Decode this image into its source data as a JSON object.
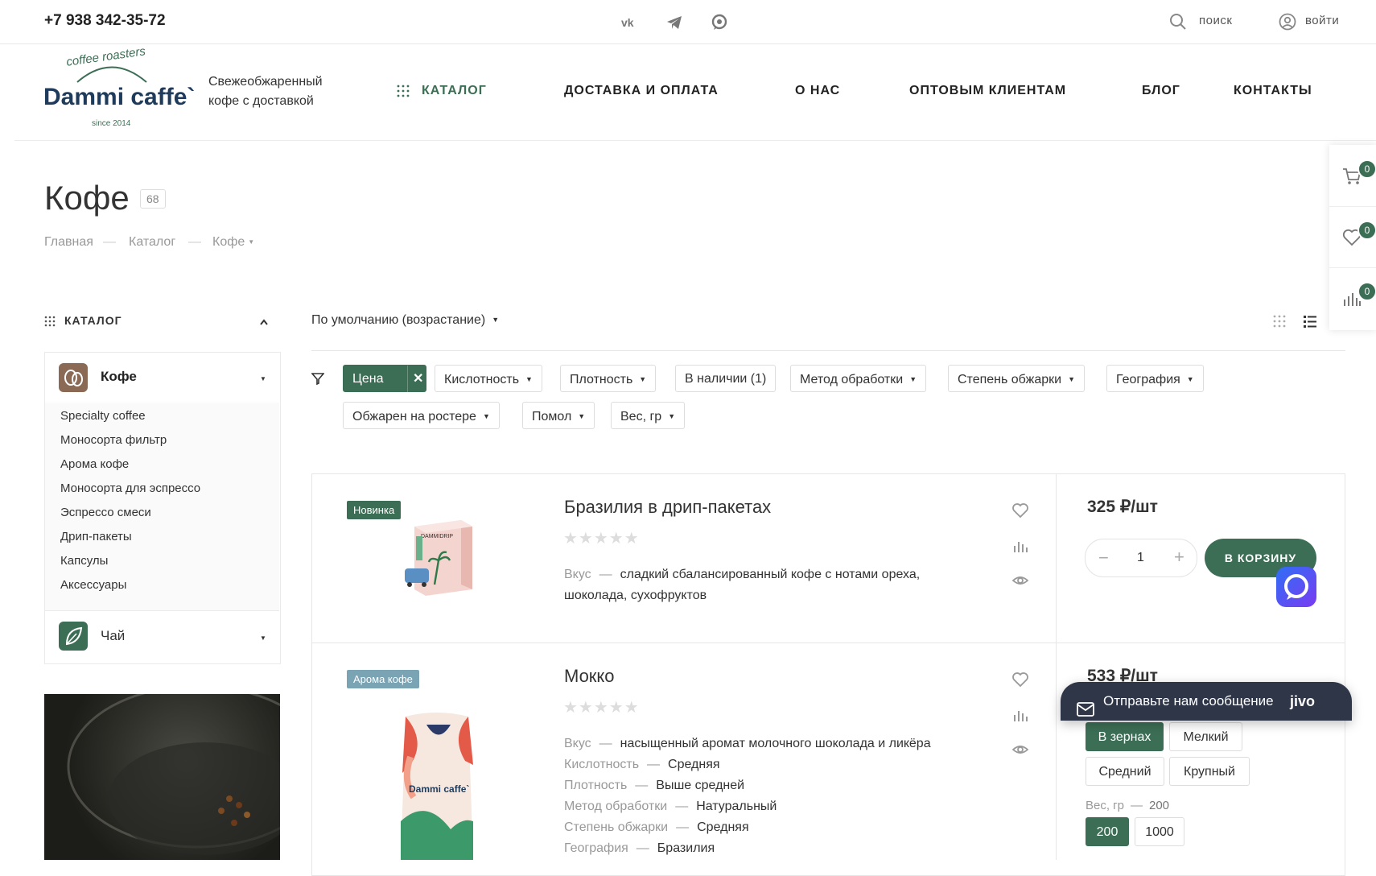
{
  "topbar": {
    "phone": "+7 938 342-35-72",
    "search_label": "поиск",
    "login_label": "войти"
  },
  "header": {
    "logo_arc_text": "coffee roasters",
    "logo_name": "Dammi caffe`",
    "logo_since": "since 2014",
    "tagline_line1": "Свежеобжаренный",
    "tagline_line2": "кофе с доставкой",
    "nav": [
      "КАТАЛОГ",
      "ДОСТАВКА И ОПЛАТА",
      "О НАС",
      "ОПТОВЫМ КЛИЕНТАМ",
      "БЛОГ",
      "КОНТАКТЫ"
    ]
  },
  "rail": {
    "cart_count": "0",
    "favorites_count": "0",
    "compare_count": "0"
  },
  "page": {
    "title": "Кофе",
    "count": "68",
    "breadcrumb": [
      "Главная",
      "Каталог",
      "Кофе"
    ]
  },
  "sidebar": {
    "heading": "КАТАЛОГ",
    "section_coffee": "Кофе",
    "items": [
      "Specialty coffee",
      "Моносорта фильтр",
      "Арома кофе",
      "Моносорта для эспрессо",
      "Эспрессо смеси",
      "Дрип-пакеты",
      "Капсулы",
      "Аксессуары"
    ],
    "section_tea": "Чай"
  },
  "sort": {
    "label": "По умолчанию (возрастание)"
  },
  "filters": {
    "row1": [
      "Цена",
      "Кислотность",
      "Плотность",
      "В наличии (1)",
      "Метод обработки",
      "Степень обжарки",
      "География"
    ],
    "row2": [
      "Обжарен на ростере",
      "Помол",
      "Вес, гр"
    ]
  },
  "products": [
    {
      "tag": "Новинка",
      "tag_color": "#3c6e55",
      "pack_text": "DAMMIDRIP",
      "title": "Бразилия в дрип-пакетах",
      "props": [
        {
          "k": "Вкус",
          "v": "сладкий сбалансированный кофе с нотами ореха,"
        },
        {
          "k": "",
          "v": "шоколада, сухофруктов"
        }
      ],
      "price": "325 ₽/шт",
      "qty": "1",
      "cart_label": "В КОРЗИНУ"
    },
    {
      "tag": "Арома кофе",
      "tag_color": "#7aa3b4",
      "pack_text": "Dammi caffe`",
      "title": "Мокко",
      "props": [
        {
          "k": "Вкус",
          "v": "насыщенный аромат молочного шоколада и ликёра"
        },
        {
          "k": "Кислотность",
          "v": "Средняя"
        },
        {
          "k": "Плотность",
          "v": "Выше средней"
        },
        {
          "k": "Метод обработки",
          "v": "Натуральный"
        },
        {
          "k": "Степень обжарки",
          "v": "Средняя"
        },
        {
          "k": "География",
          "v": "Бразилия"
        }
      ],
      "price": "533 ₽/шт",
      "grind_options": [
        "В зернах",
        "Мелкий",
        "Средний",
        "Крупный"
      ],
      "weight_label": "Вес, гр",
      "weight_value": "200",
      "weight_options": [
        "200",
        "1000"
      ]
    }
  ],
  "jivo": {
    "label": "Отправьте нам сообщение",
    "brand": "jivo"
  },
  "colors": {
    "accent": "#3c6e55",
    "jivo_bg": "#2f3648"
  }
}
